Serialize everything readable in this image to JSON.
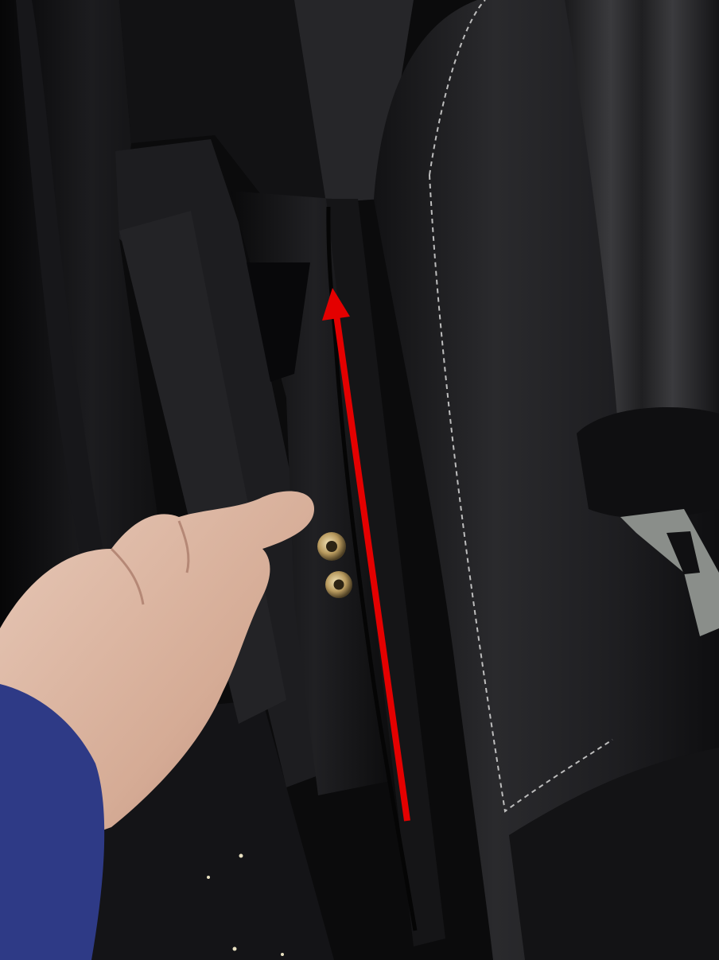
{
  "photo": {
    "subject": "vehicle-seat-side-trim-with-cable",
    "colors": {
      "background": "#0b0b0c",
      "door_panel": "#1a1a1c",
      "bracket": "#0f0f10",
      "seat_leather": "#1c1c1e",
      "stitching": "#c9c9c9",
      "seatbelt": "#2a2a2c",
      "skin": "#d9b7a4",
      "sleeve": "#2e3a86",
      "bolt": "#c8b07a",
      "arrow": "#e40000"
    }
  }
}
